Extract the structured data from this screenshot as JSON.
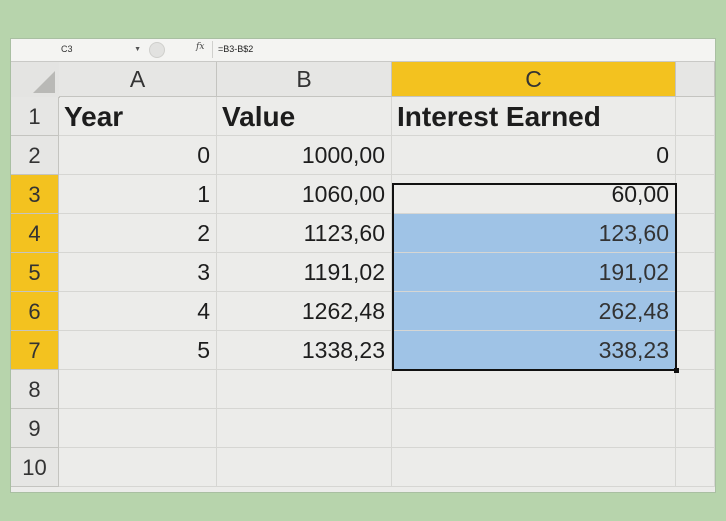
{
  "formula_bar": {
    "name_box": "C3",
    "fx_label": "fx",
    "formula": "=B3-B$2"
  },
  "columns": [
    "A",
    "B",
    "C"
  ],
  "active_column": "C",
  "rows": [
    "1",
    "2",
    "3",
    "4",
    "5",
    "6",
    "7",
    "8",
    "9",
    "10"
  ],
  "active_rows": [
    "3",
    "4",
    "5",
    "6",
    "7"
  ],
  "cells": {
    "A1": "Year",
    "B1": "Value",
    "C1": "Interest Earned",
    "A2": "0",
    "B2": "1000,00",
    "C2": "0",
    "A3": "1",
    "B3": "1060,00",
    "C3": "60,00",
    "A4": "2",
    "B4": "1123,60",
    "C4": "123,60",
    "A5": "3",
    "B5": "1191,02",
    "C5": "191,02",
    "A6": "4",
    "B6": "1262,48",
    "C6": "262,48",
    "A7": "5",
    "B7": "1338,23",
    "C7": "338,23"
  },
  "colors": {
    "active_header": "#f3c21f",
    "selection_fill": "#9fc3e6",
    "background": "#b7d4ac"
  }
}
